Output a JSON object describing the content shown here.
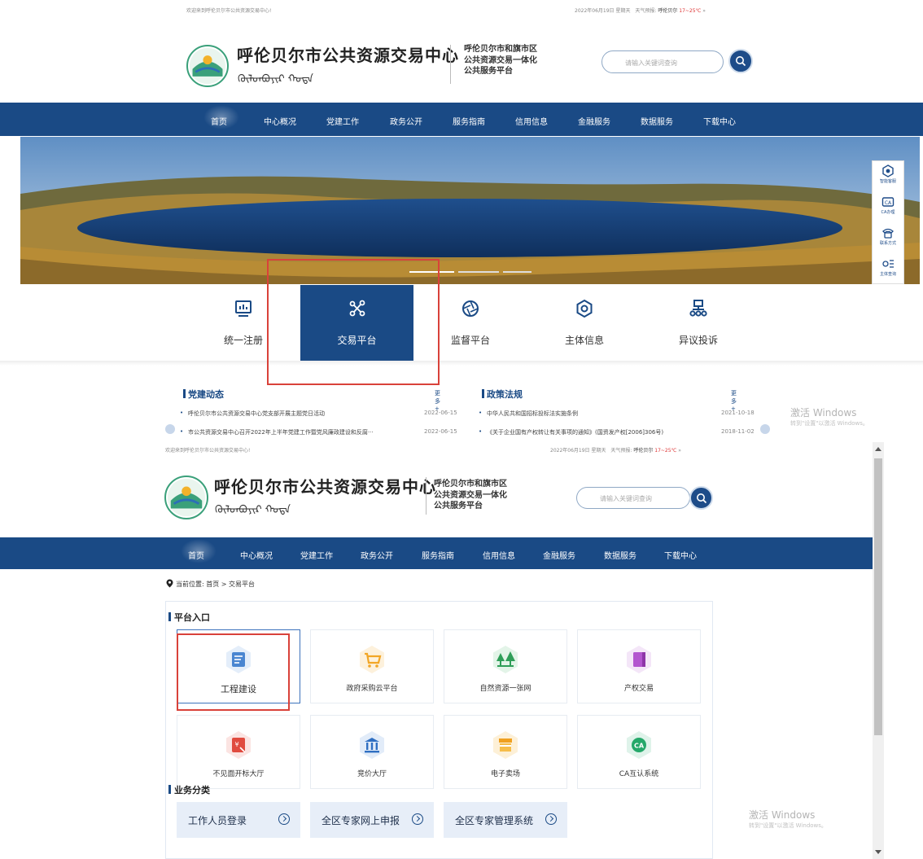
{
  "site": {
    "welcome": "欢迎来到呼伦贝尔市公共资源交易中心!",
    "date_text": "2022年06月19日 星期天",
    "weather_label": "天气预报:",
    "weather_city": "呼伦贝尔",
    "weather_temp": "17~25℃",
    "weather_more": "»",
    "title": "呼伦贝尔市公共资源交易中心",
    "mongol_text": "ᠬᠥᠯᠦᠨᠪᠤᠶᠢᠷ ᠬᠣᠲᠠ",
    "subtitle_lines": [
      "呼伦贝尔市和旗市区",
      "公共资源交易一体化",
      "公共服务平台"
    ],
    "search_placeholder": "请输入关键词查询"
  },
  "nav": [
    "首页",
    "中心概况",
    "党建工作",
    "政务公开",
    "服务指南",
    "信用信息",
    "金融服务",
    "数据服务",
    "下载中心"
  ],
  "side_panel": [
    "智能客服",
    "CA办理",
    "联系方式",
    "主体查询"
  ],
  "quick_entries": [
    {
      "label": "统一注册",
      "icon": "monitor-chart-icon"
    },
    {
      "label": "交易平台",
      "icon": "network-nodes-icon"
    },
    {
      "label": "监督平台",
      "icon": "aperture-icon"
    },
    {
      "label": "主体信息",
      "icon": "hexagon-icon"
    },
    {
      "label": "异议投诉",
      "icon": "org-chart-icon"
    }
  ],
  "news": {
    "party": {
      "title": "党建动态",
      "more": "更多+",
      "items": [
        {
          "text": "呼伦贝尔市公共资源交易中心党支部开展主题党日活动",
          "date": "2022-06-15"
        },
        {
          "text": "市公共资源交易中心召开2022年上半年党建工作暨党风廉政建设和反腐···",
          "date": "2022-06-15"
        }
      ]
    },
    "policy": {
      "title": "政策法规",
      "more": "更多+",
      "items": [
        {
          "text": "中华人民共和国招标投标法实施条例",
          "date": "2021-10-18"
        },
        {
          "text": "《关于企业国有产权转让有关事项的通知》(国资发产权[2006]306号)",
          "date": "2018-11-02"
        }
      ]
    }
  },
  "watermark": {
    "title": "激活 Windows",
    "sub_top": "转到\"设置\"以激活 Windows。",
    "sub_bottom": "转到\"设置\"以激活 Windows。"
  },
  "breadcrumb": "当前位置: 首页 > 交易平台",
  "platform_section": "平台入口",
  "platform_cards": [
    {
      "label": "工程建设",
      "icon": "document-icon"
    },
    {
      "label": "政府采购云平台",
      "icon": "shopping-cart-icon"
    },
    {
      "label": "自然资源一张网",
      "icon": "trees-icon"
    },
    {
      "label": "产权交易",
      "icon": "book-icon"
    },
    {
      "label": "不见面开标大厅",
      "icon": "yuan-card-icon"
    },
    {
      "label": "竞价大厅",
      "icon": "bank-icon"
    },
    {
      "label": "电子卖场",
      "icon": "store-icon"
    },
    {
      "label": "CA互认系统",
      "icon": "ca-badge-icon"
    }
  ],
  "business_section": "业务分类",
  "business_buttons": [
    "工作人员登录",
    "全区专家网上申报",
    "全区专家管理系统"
  ],
  "colors": {
    "primary": "#1a4a85",
    "highlight": "#d9423a"
  }
}
